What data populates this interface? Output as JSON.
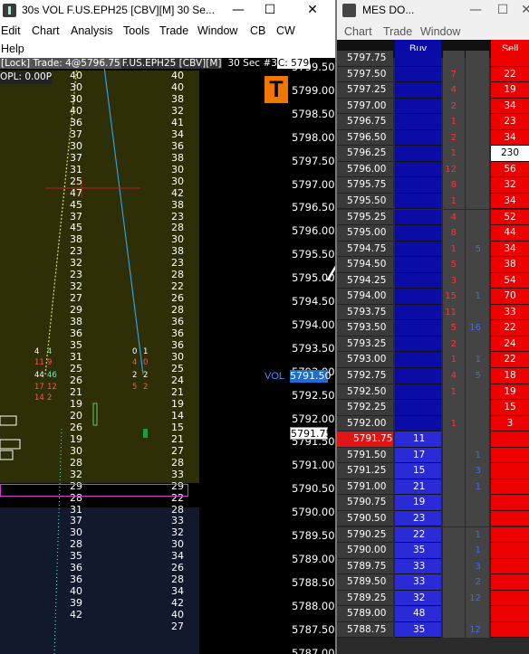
{
  "left_window": {
    "title": "30s VOL F.US.EPH25 [CBV][M]  30 Se...",
    "controls": {
      "minimize": "—",
      "maximize": "☐",
      "close": "✕"
    },
    "menu": [
      "Edit",
      "Chart",
      "Analysis",
      "Tools",
      "Trade",
      "Window",
      "CB",
      "CW"
    ],
    "menu2": [
      "Help"
    ],
    "info_bar": {
      "lock": "[Lock] Trade: 4@5796.75",
      "symbol": "F.US.EPH25 [CBV][M]",
      "interval": "30 Sec",
      "num": "#3",
      "close": "C: 579"
    },
    "opl": "OPL: 0.00P",
    "logo_letter": "T",
    "vol_label": "VOL",
    "vol_price": "5791.50",
    "current_price": "5791.75",
    "price_axis": [
      "5799.50",
      "5799.00",
      "5798.50",
      "5798.00",
      "5797.50",
      "5797.00",
      "5796.50",
      "5796.00",
      "5795.50",
      "5795.00",
      "5794.50",
      "5794.00",
      "5793.50",
      "5793.00",
      "5792.50",
      "5792.00",
      "5791.50",
      "5791.00",
      "5790.50",
      "5790.00",
      "5789.50",
      "5789.00",
      "5788.50",
      "5788.00",
      "5787.50",
      "5787.00"
    ],
    "left_values": [
      "40",
      "30",
      "30",
      "40",
      "36",
      "37",
      "30",
      "37",
      "31",
      "25",
      "47",
      "45",
      "37",
      "45",
      "38",
      "23",
      "32",
      "23",
      "32",
      "27",
      "29",
      "38",
      "36",
      "35",
      "31",
      "25",
      "26",
      "21",
      "19",
      "20",
      "26",
      "19",
      "30",
      "28",
      "32",
      "29",
      "28",
      "31",
      "37",
      "30",
      "28",
      "35",
      "36",
      "36",
      "40",
      "39",
      "42"
    ],
    "right_values": [
      "40",
      "40",
      "38",
      "32",
      "41",
      "34",
      "36",
      "38",
      "30",
      "30",
      "42",
      "38",
      "23",
      "28",
      "30",
      "38",
      "23",
      "28",
      "22",
      "26",
      "28",
      "36",
      "36",
      "36",
      "30",
      "25",
      "24",
      "21",
      "19",
      "14",
      "15",
      "21",
      "27",
      "28",
      "33",
      "29",
      "22",
      "28",
      "33",
      "32",
      "30",
      "34",
      "26",
      "28",
      "34",
      "42",
      "40",
      "27"
    ],
    "footprint": [
      {
        "l1": "4",
        "l2": "4",
        "r1": "0",
        "r2": "1"
      },
      {
        "l1": "11",
        "l2": "9",
        "r1": "4",
        "r2": "0"
      },
      {
        "l1": "44",
        "l2": "46",
        "r1": "2",
        "r2": "2"
      },
      {
        "l1": "17",
        "l2": "12",
        "r1": "5",
        "r2": "2"
      },
      {
        "l1": "14",
        "l2": "2",
        "r1": "",
        "r2": ""
      }
    ]
  },
  "right_window": {
    "title": "MES DO...",
    "controls": {
      "minimize": "—",
      "maximize": "☐",
      "close": "✕"
    },
    "menu": [
      "Chart",
      "Trade",
      "Window"
    ],
    "buy_header": "Buy",
    "sell_header": "Sell",
    "ladder": [
      {
        "price": "5797.75",
        "buy": "",
        "a": "",
        "b": "",
        "sell": ""
      },
      {
        "price": "5797.50",
        "buy": "",
        "a": "7",
        "b": "",
        "sell": "22"
      },
      {
        "price": "5797.25",
        "buy": "",
        "a": "4",
        "b": "",
        "sell": "19"
      },
      {
        "price": "5797.00",
        "buy": "",
        "a": "2",
        "b": "",
        "sell": "34"
      },
      {
        "price": "5796.75",
        "buy": "",
        "a": "1",
        "b": "",
        "sell": "23"
      },
      {
        "price": "5796.50",
        "buy": "",
        "a": "2",
        "b": "",
        "sell": "34"
      },
      {
        "price": "5796.25",
        "buy": "",
        "a": "1",
        "b": "",
        "sell": "230"
      },
      {
        "price": "5796.00",
        "buy": "",
        "a": "12",
        "b": "",
        "sell": "56"
      },
      {
        "price": "5795.75",
        "buy": "",
        "a": "8",
        "b": "",
        "sell": "32"
      },
      {
        "price": "5795.50",
        "buy": "",
        "a": "1",
        "b": "",
        "sell": "34"
      },
      {
        "price": "5795.25",
        "buy": "",
        "a": "4",
        "b": "",
        "sell": "52"
      },
      {
        "price": "5795.00",
        "buy": "",
        "a": "8",
        "b": "",
        "sell": "44"
      },
      {
        "price": "5794.75",
        "buy": "",
        "a": "1",
        "b": "5",
        "sell": "34"
      },
      {
        "price": "5794.50",
        "buy": "",
        "a": "5",
        "b": "",
        "sell": "38"
      },
      {
        "price": "5794.25",
        "buy": "",
        "a": "3",
        "b": "",
        "sell": "54"
      },
      {
        "price": "5794.00",
        "buy": "",
        "a": "15",
        "b": "1",
        "sell": "70"
      },
      {
        "price": "5793.75",
        "buy": "",
        "a": "11",
        "b": "",
        "sell": "33"
      },
      {
        "price": "5793.50",
        "buy": "",
        "a": "5",
        "b": "16",
        "sell": "22"
      },
      {
        "price": "5793.25",
        "buy": "",
        "a": "2",
        "b": "",
        "sell": "24"
      },
      {
        "price": "5793.00",
        "buy": "",
        "a": "1",
        "b": "1",
        "sell": "22"
      },
      {
        "price": "5792.75",
        "buy": "",
        "a": "4",
        "b": "5",
        "sell": "18"
      },
      {
        "price": "5792.50",
        "buy": "",
        "a": "1",
        "b": "",
        "sell": "19"
      },
      {
        "price": "5792.25",
        "buy": "",
        "a": "",
        "b": "",
        "sell": "15"
      },
      {
        "price": "5792.00",
        "buy": "",
        "a": "1",
        "b": "",
        "sell": "3"
      },
      {
        "price": "5791.75",
        "buy": "11",
        "a": "",
        "b": "",
        "sell": ""
      },
      {
        "price": "5791.50",
        "buy": "17",
        "a": "",
        "b": "1",
        "sell": ""
      },
      {
        "price": "5791.25",
        "buy": "15",
        "a": "",
        "b": "3",
        "sell": ""
      },
      {
        "price": "5791.00",
        "buy": "21",
        "a": "",
        "b": "1",
        "sell": ""
      },
      {
        "price": "5790.75",
        "buy": "19",
        "a": "",
        "b": "",
        "sell": ""
      },
      {
        "price": "5790.50",
        "buy": "23",
        "a": "",
        "b": "",
        "sell": ""
      },
      {
        "price": "5790.25",
        "buy": "22",
        "a": "",
        "b": "1",
        "sell": ""
      },
      {
        "price": "5790.00",
        "buy": "35",
        "a": "",
        "b": "1",
        "sell": ""
      },
      {
        "price": "5789.75",
        "buy": "33",
        "a": "",
        "b": "3",
        "sell": ""
      },
      {
        "price": "5789.50",
        "buy": "33",
        "a": "",
        "b": "2",
        "sell": ""
      },
      {
        "price": "5789.25",
        "buy": "32",
        "a": "",
        "b": "12",
        "sell": ""
      },
      {
        "price": "5789.00",
        "buy": "48",
        "a": "",
        "b": "",
        "sell": ""
      },
      {
        "price": "5788.75",
        "buy": "35",
        "a": "",
        "b": "12",
        "sell": ""
      }
    ],
    "last_price_row": "5791.75",
    "hot_sell": "230"
  }
}
